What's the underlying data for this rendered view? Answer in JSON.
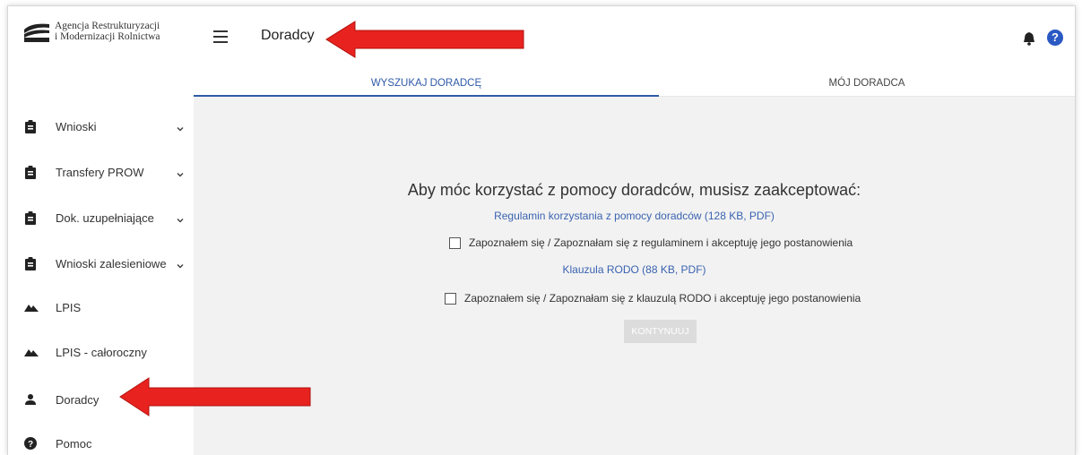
{
  "app": {
    "logo_line1": "Agencja Restrukturyzacji",
    "logo_line2": "i Modernizacji Rolnictwa",
    "page_title": "Doradcy"
  },
  "sidebar": {
    "items": [
      {
        "label": "Wnioski",
        "icon": "clipboard-icon",
        "expandable": true
      },
      {
        "label": "Transfery PROW",
        "icon": "clipboard-icon",
        "expandable": true
      },
      {
        "label": "Dok. uzupełniające",
        "icon": "clipboard-icon",
        "expandable": true
      },
      {
        "label": "Wnioski zalesieniowe",
        "icon": "clipboard-icon",
        "expandable": true
      },
      {
        "label": "LPIS",
        "icon": "terrain-icon",
        "expandable": false
      },
      {
        "label": "LPIS - całoroczny",
        "icon": "terrain-icon",
        "expandable": false
      },
      {
        "label": "Doradcy",
        "icon": "person-icon",
        "expandable": false
      },
      {
        "label": "Pomoc",
        "icon": "help-circle-icon",
        "expandable": false
      }
    ]
  },
  "tabs": [
    {
      "label": "WYSZUKAJ DORADCĘ",
      "active": true
    },
    {
      "label": "MÓJ DORADCA",
      "active": false
    }
  ],
  "main": {
    "heading": "Aby móc korzystać z pomocy doradców, musisz zaakceptować:",
    "regulamin_link": "Regulamin korzystania z pomocy doradców (128 KB, PDF)",
    "regulamin_check": "Zapoznałem się / Zapoznałam się z regulaminem i akceptuję jego postanowienia",
    "rodo_link": "Klauzula RODO (88 KB, PDF)",
    "rodo_check": "Zapoznałem się / Zapoznałam się z klauzulą RODO i akceptuję jego postanowienia",
    "continue_button": "KONTYNUUJ"
  },
  "colors": {
    "accent": "#2f5aa8",
    "annotation_arrow": "#e8231f",
    "content_bg": "#f2f2f2"
  }
}
